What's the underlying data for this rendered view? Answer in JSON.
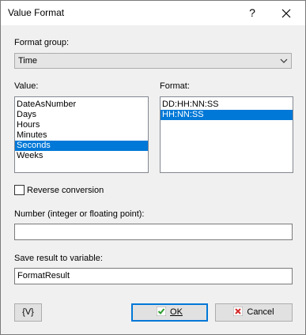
{
  "window": {
    "title": "Value Format",
    "help_label": "?",
    "close_label": "✕"
  },
  "format_group": {
    "label": "Format group:",
    "selected": "Time",
    "icon": "chevron-down-icon"
  },
  "value_list": {
    "label": "Value:",
    "items": [
      "DateAsNumber",
      "Days",
      "Hours",
      "Minutes",
      "Seconds",
      "Weeks"
    ],
    "selected": "Seconds"
  },
  "format_list": {
    "label": "Format:",
    "items": [
      "DD:HH:NN:SS",
      "HH:NN:SS"
    ],
    "selected": "HH:NN:SS"
  },
  "reverse_conversion": {
    "label": "Reverse conversion",
    "checked": false
  },
  "number_field": {
    "label": "Number (integer or floating point):",
    "value": ""
  },
  "result_field": {
    "label": "Save result to variable:",
    "value": "FormatResult"
  },
  "buttons": {
    "variable_label": "{V}",
    "ok_label": "OK",
    "cancel_label": "Cancel"
  },
  "colors": {
    "selection": "#0078d7",
    "ok_icon": "#2d9b2d",
    "cancel_icon": "#d42a2a"
  }
}
